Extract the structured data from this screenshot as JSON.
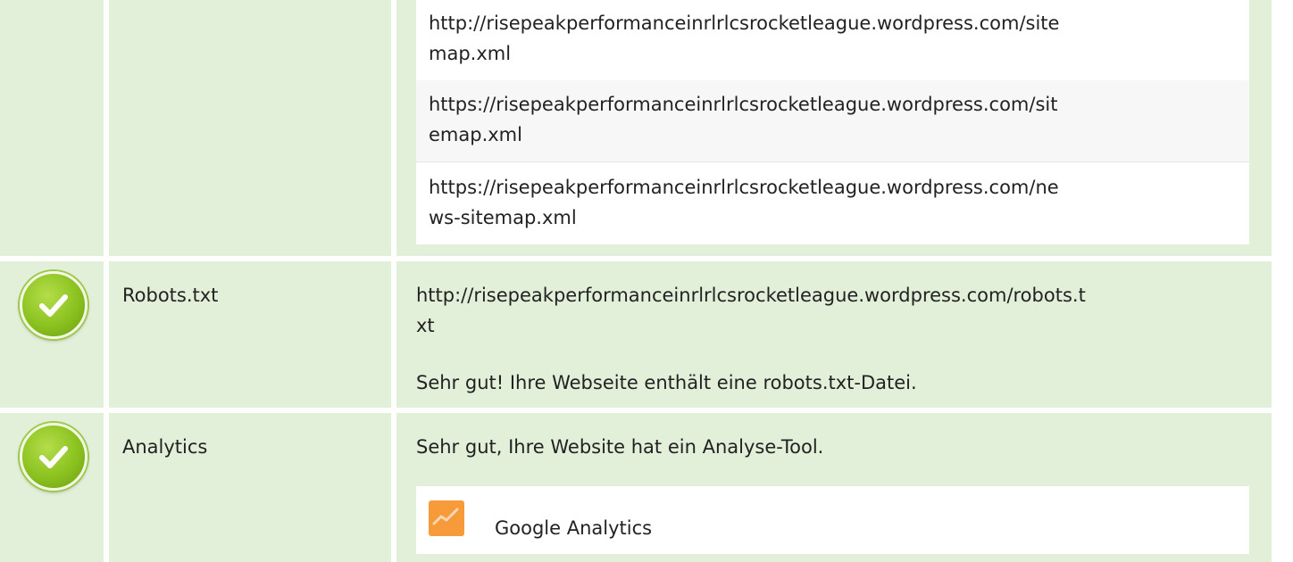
{
  "sitemap": {
    "urls": [
      [
        "http://risepeakperformanceinrlrlcsrocketleague.wordpress.com/site",
        "map.xml"
      ],
      [
        "https://risepeakperformanceinrlrlcsrocketleague.wordpress.com/sit",
        "emap.xml"
      ],
      [
        "https://risepeakperformanceinrlrlcsrocketleague.wordpress.com/ne",
        "ws-sitemap.xml"
      ]
    ]
  },
  "robots": {
    "label": "Robots.txt",
    "url_lines": [
      "http://risepeakperformanceinrlrlcsrocketleague.wordpress.com/robots.t",
      "xt"
    ],
    "message": "Sehr gut! Ihre Webseite enthält eine robots.txt-Datei."
  },
  "analytics": {
    "label": "Analytics",
    "message": "Sehr gut, Ihre Website hat ein Analyse-Tool.",
    "tool_name": "Google Analytics",
    "tool_icon": "google-analytics-icon"
  },
  "icons": {
    "status": "check-circle-icon"
  },
  "colors": {
    "cell_bg": "#e2f0da",
    "accent_green": "#8bc21f",
    "ga_orange": "#f79a3a"
  }
}
